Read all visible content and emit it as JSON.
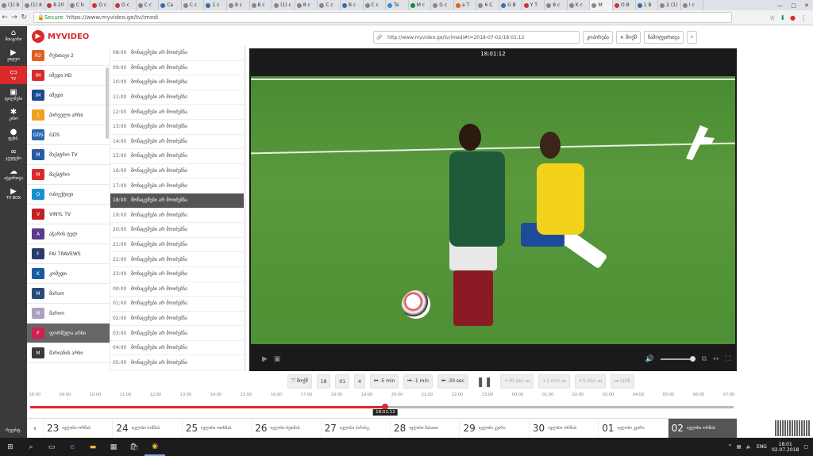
{
  "browser": {
    "tabs": [
      "(1) 8",
      "(1) 8",
      "8 20",
      "C b",
      "O c",
      "O c",
      "C c",
      "Ca",
      "C c",
      "1 c",
      "8 c",
      "8 c",
      "(1) c",
      "8 c",
      "C c",
      "B c",
      "C c",
      "Ta",
      "M c",
      "G c",
      "a T",
      "6 C",
      "G B",
      "Y T",
      "8 c",
      "K c",
      "M",
      "O B",
      "1 B",
      "2 (1)",
      "I c"
    ],
    "secure_label": "Secure",
    "url": "https://www.myvideo.ge/tv/imedi"
  },
  "rail": {
    "items": [
      {
        "icon": "⌂",
        "label": "მთავარი"
      },
      {
        "icon": "▶",
        "label": "ვიდეო"
      },
      {
        "icon": "▭",
        "label": "TV"
      },
      {
        "icon": "▣",
        "label": "ფილმები"
      },
      {
        "icon": "✱",
        "label": "კინო"
      },
      {
        "icon": "●",
        "label": "ფეხბ."
      },
      {
        "icon": "∞",
        "label": "ჯგუფები"
      },
      {
        "icon": "☁",
        "label": "ატვირთვა"
      },
      {
        "icon": "▶",
        "label": "TV BOX"
      }
    ],
    "lang": "რეგისტ."
  },
  "logo": {
    "mark": "⚪",
    "text": "MYVIDEO"
  },
  "channels": [
    {
      "name": "რუსთავი 2",
      "color": "#e06020",
      "abbr": "R2"
    },
    {
      "name": "იმედი HD",
      "color": "#d92b2b",
      "abbr": "IM"
    },
    {
      "name": "იმედი",
      "color": "#1a4a8a",
      "abbr": "IM"
    },
    {
      "name": "პირველი არხი",
      "color": "#f2a020",
      "abbr": "1"
    },
    {
      "name": "GDS",
      "color": "#2a6ab0",
      "abbr": "GDS"
    },
    {
      "name": "მაესტრო TV",
      "color": "#2a5aa0",
      "abbr": "M"
    },
    {
      "name": "მაესტრო",
      "color": "#d92b2b",
      "abbr": "M"
    },
    {
      "name": "ობიექტივი",
      "color": "#1a90d0",
      "abbr": "O"
    },
    {
      "name": "VINYL TV",
      "color": "#c02020",
      "abbr": "V"
    },
    {
      "name": "აჭარის ტელ",
      "color": "#5a3a8a",
      "abbr": "A"
    },
    {
      "name": "FAI TRAVEWS",
      "color": "#2a3a6a",
      "abbr": "F"
    },
    {
      "name": "კომედი",
      "color": "#1a5aa0",
      "abbr": "K"
    },
    {
      "name": "მარაო",
      "color": "#2a4a7a",
      "abbr": "M"
    },
    {
      "name": "მარიო",
      "color": "#b0a0c0",
      "abbr": "M"
    },
    {
      "name": "ფორმულა არხი",
      "color": "#d02050",
      "abbr": "F"
    },
    {
      "name": "მარიანის არხი",
      "color": "#3a3a3a",
      "abbr": "M"
    }
  ],
  "schedule": [
    {
      "time": "08:00",
      "title": "მონაცემები არ მოიძებნა"
    },
    {
      "time": "09:00",
      "title": "მონაცემები არ მოიძებნა"
    },
    {
      "time": "10:00",
      "title": "მონაცემები არ მოიძებნა"
    },
    {
      "time": "11:00",
      "title": "მონაცემები არ მოიძებნა"
    },
    {
      "time": "12:00",
      "title": "მონაცემები არ მოიძებნა"
    },
    {
      "time": "13:00",
      "title": "მონაცემები არ მოიძებნა"
    },
    {
      "time": "14:00",
      "title": "მონაცემები არ მოიძებნა"
    },
    {
      "time": "15:00",
      "title": "მონაცემები არ მოიძებნა"
    },
    {
      "time": "16:00",
      "title": "მონაცემები არ მოიძებნა"
    },
    {
      "time": "17:00",
      "title": "მონაცემები არ მოიძებნა"
    },
    {
      "time": "18:00",
      "title": "მონაცემები არ მოიძებნა"
    },
    {
      "time": "19:00",
      "title": "მონაცემები არ მოიძებნა"
    },
    {
      "time": "20:00",
      "title": "მონაცემები არ მოიძებნა"
    },
    {
      "time": "21:00",
      "title": "მონაცემები არ მოიძებნა"
    },
    {
      "time": "22:00",
      "title": "მონაცემები არ მოიძებნა"
    },
    {
      "time": "23:00",
      "title": "მონაცემები არ მოიძებნა"
    },
    {
      "time": "00:00",
      "title": "მონაცემები არ მოიძებნა"
    },
    {
      "time": "01:00",
      "title": "მონაცემები არ მოიძებნა"
    },
    {
      "time": "02:00",
      "title": "მონაცემები არ მოიძებნა"
    },
    {
      "time": "03:00",
      "title": "მონაცემები არ მოიძებნა"
    },
    {
      "time": "04:00",
      "title": "მონაცემები არ მოიძებნა"
    },
    {
      "time": "05:00",
      "title": "მონაცემები არ მოიძებნა"
    }
  ],
  "schedule_active_index": 10,
  "player": {
    "time": "18:01:12",
    "share_url": "http://www.myvideo.ge/tv/imedi#t=2018-07-02/18:01:12",
    "copy_label": "კოპირება",
    "close_label": "✕ მოქმ",
    "download_label": "ჩამოტვირთვა",
    "search_icon": "⌕"
  },
  "controls": {
    "back_label": "⤧ მოქმ",
    "hour": "18",
    "minute": "01",
    "sec": "4",
    "minus5": "⏮ -5 min",
    "minus1": "⏮ -1 min",
    "minus30s": "⏮ -30 sec",
    "plus30s": "+30 sec ⏭",
    "plus1": "+1 min ⏭",
    "plus5": "+5 min ⏭",
    "live": "⏭ LIVE"
  },
  "timeline": {
    "ticks": [
      "16:00",
      "09:00",
      "10:00",
      "11:00",
      "12:00",
      "13:00",
      "14:00",
      "15:00",
      "16:00",
      "17:00",
      "18:00",
      "19:00",
      "20:00",
      "21:00",
      "22:00",
      "23:00",
      "00:00",
      "01:00",
      "02:00",
      "03:00",
      "04:00",
      "05:00",
      "06:00",
      "07:00"
    ],
    "progress": 0.505,
    "current": "18:01:12"
  },
  "days": [
    {
      "num": "23",
      "label": "ივლისი ორშაბ."
    },
    {
      "num": "24",
      "label": "ივლისი სამშაბ."
    },
    {
      "num": "25",
      "label": "ივლისი ოთხშაბ."
    },
    {
      "num": "26",
      "label": "ივლისი ხუთშაბ."
    },
    {
      "num": "27",
      "label": "ივლისი პარასკ."
    },
    {
      "num": "28",
      "label": "ივლისი შაბათი"
    },
    {
      "num": "29",
      "label": "ივლისი კვირა"
    },
    {
      "num": "30",
      "label": "ივლისი ორშაბ."
    },
    {
      "num": "01",
      "label": "ივლისი კვირა"
    },
    {
      "num": "02",
      "label": "ივლისი ორშაბ."
    }
  ],
  "taskbar": {
    "lang": "ENG",
    "time": "18:01",
    "date": "02.07.2018"
  }
}
